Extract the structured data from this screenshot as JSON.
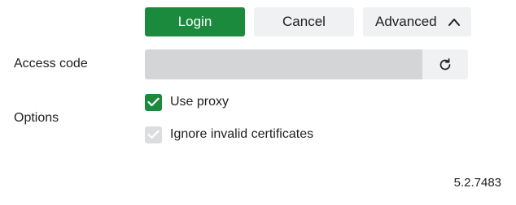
{
  "toolbar": {
    "login_label": "Login",
    "cancel_label": "Cancel",
    "advanced_label": "Advanced",
    "advanced_icon": "chevron-up-icon"
  },
  "access_code": {
    "label": "Access code",
    "value": "",
    "refresh_icon": "refresh-icon"
  },
  "options": {
    "label": "Options",
    "items": [
      {
        "label": "Use proxy",
        "checked": true,
        "enabled": true
      },
      {
        "label": "Ignore invalid certificates",
        "checked": true,
        "enabled": false
      }
    ]
  },
  "footer": {
    "version": "5.2.7483"
  },
  "colors": {
    "accent": "#1b8a3d",
    "button_bg": "#f0f1f2",
    "field_bg": "#d4d5d6",
    "disabled_check": "#dcdddf"
  }
}
